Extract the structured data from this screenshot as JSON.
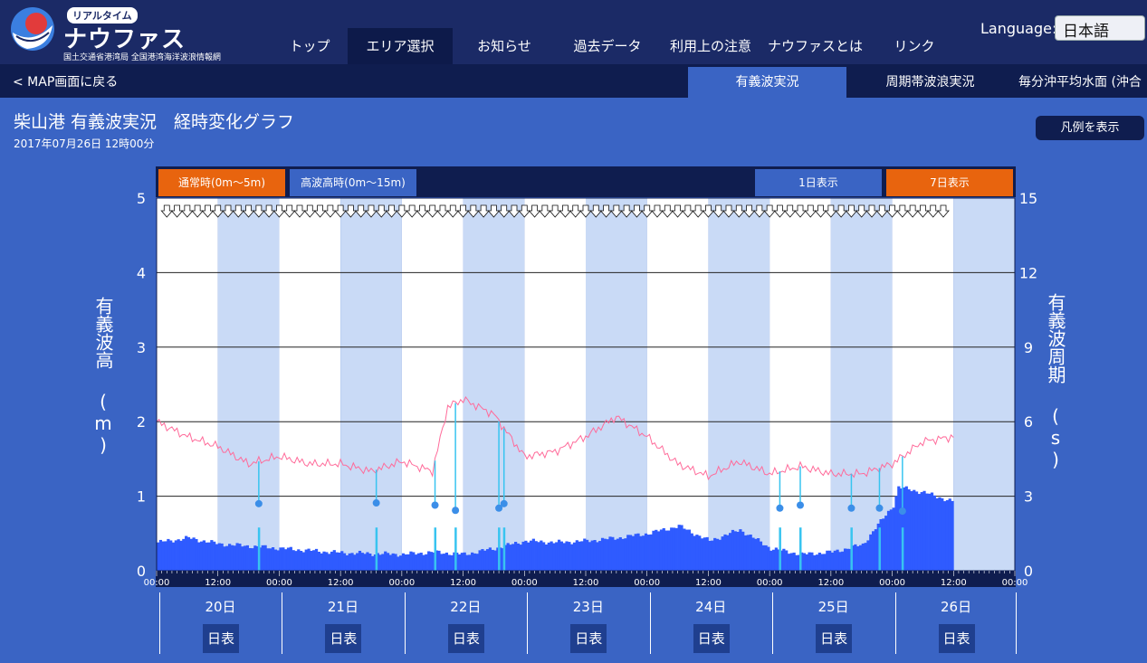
{
  "header": {
    "badge": "リアルタイム",
    "brand": "ナウファス",
    "subtitle": "国土交通省港湾局 全国港湾海洋波浪情報網",
    "nav": [
      "トップ",
      "エリア選択",
      "お知らせ",
      "過去データ",
      "利用上の注意",
      "ナウファスとは",
      "リンク"
    ],
    "active_nav": "エリア選択",
    "language_label": "Language:",
    "language_value": "日本語"
  },
  "subbar": {
    "back_link": "< MAP画面に戻る",
    "tabs": [
      "有義波実況",
      "周期帯波浪実況",
      "毎分沖平均水面 (沖合"
    ]
  },
  "page": {
    "title": "柴山港 有義波実況　経時変化グラフ",
    "date": "2017年07月26日 12時00分",
    "legend_button": "凡例を表示"
  },
  "chart_controls": {
    "normal": "通常時(0m〜5m)",
    "high": "高波高時(0m〜15m)",
    "one_day": "1日表示",
    "seven_day": "7日表示"
  },
  "days": [
    "20日",
    "21日",
    "22日",
    "23日",
    "24日",
    "25日",
    "26日"
  ],
  "day_button": "日表",
  "colors": {
    "height_bar": "#2f5bff",
    "period_line": "#ff6b9a",
    "anomaly": "#38c4f0",
    "band_light": "#c9daf6",
    "band_white": "#ffffff"
  },
  "chart_data": {
    "type": "bar",
    "xlabel": "",
    "ylabel": "有義波高 (m)",
    "y2label": "有義波周期 (s)",
    "ylim": [
      0,
      5
    ],
    "y2lim": [
      0,
      15
    ],
    "yticks": [
      "0",
      "1",
      "2",
      "3",
      "4",
      "5"
    ],
    "y2ticks": [
      "0",
      "3",
      "6",
      "9",
      "12",
      "15"
    ],
    "xticks": [
      "00:00",
      "12:00",
      "00:00",
      "12:00",
      "00:00",
      "12:00",
      "00:00",
      "12:00",
      "00:00",
      "12:00",
      "00:00",
      "12:00",
      "00:00",
      "12:00",
      "00:00"
    ],
    "x_hours_total": 168,
    "data_end_hour": 156,
    "grid": true,
    "series": [
      {
        "kind": "bar",
        "hours": [
          0,
          6,
          12,
          18,
          24,
          30,
          36,
          42,
          48,
          54,
          60,
          66,
          72,
          78,
          84,
          90,
          96,
          102,
          108,
          114,
          120,
          126,
          132,
          138,
          144,
          145,
          150,
          156
        ],
        "values": [
          0.38,
          0.44,
          0.36,
          0.33,
          0.3,
          0.27,
          0.24,
          0.23,
          0.22,
          0.25,
          0.22,
          0.3,
          0.4,
          0.38,
          0.4,
          0.44,
          0.5,
          0.6,
          0.4,
          0.55,
          0.3,
          0.22,
          0.25,
          0.35,
          0.88,
          1.12,
          1.05,
          0.92
        ]
      },
      {
        "kind": "line",
        "hours": [
          0,
          6,
          12,
          18,
          24,
          30,
          36,
          42,
          48,
          54,
          57,
          60,
          66,
          72,
          78,
          84,
          90,
          96,
          102,
          108,
          114,
          120,
          126,
          132,
          138,
          144,
          150,
          156
        ],
        "values": [
          6.0,
          5.4,
          5.0,
          4.3,
          4.6,
          4.3,
          4.3,
          4.0,
          4.4,
          4.0,
          6.6,
          6.9,
          6.3,
          4.6,
          4.8,
          5.4,
          6.2,
          5.4,
          4.3,
          3.8,
          4.4,
          3.9,
          4.2,
          3.9,
          3.9,
          4.3,
          5.2,
          5.4
        ]
      }
    ],
    "anomalies": [
      {
        "hour": 20,
        "value": 0.9
      },
      {
        "hour": 43,
        "value": 0.91
      },
      {
        "hour": 54.5,
        "value": 0.88
      },
      {
        "hour": 58.5,
        "value": 0.81
      },
      {
        "hour": 67,
        "value": 0.84
      },
      {
        "hour": 68,
        "value": 0.9
      },
      {
        "hour": 122,
        "value": 0.84
      },
      {
        "hour": 126,
        "value": 0.88
      },
      {
        "hour": 136,
        "value": 0.84
      },
      {
        "hour": 141.5,
        "value": 0.84
      },
      {
        "hour": 146,
        "value": 0.8
      }
    ]
  }
}
